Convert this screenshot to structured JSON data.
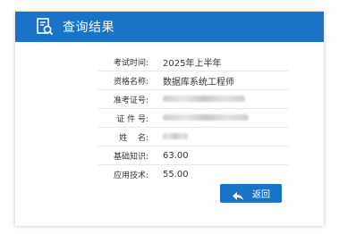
{
  "header": {
    "title": "查询结果",
    "icon": "search-document-icon"
  },
  "results": [
    {
      "label": "考试时间:",
      "value": "2025年上半年",
      "redacted": false
    },
    {
      "label": "资格名称:",
      "value": "数据库系统工程师",
      "redacted": false
    },
    {
      "label": "准考证号:",
      "value": "",
      "redacted": true
    },
    {
      "label": "证 件 号:",
      "value": "",
      "redacted": true
    },
    {
      "label": "姓　 名:",
      "value": "",
      "redacted": true
    },
    {
      "label": "基础知识:",
      "value": "63.00",
      "redacted": false
    },
    {
      "label": "应用技术:",
      "value": "55.00",
      "redacted": false
    }
  ],
  "back_button": {
    "label": "返回",
    "icon": "back-arrow-icon"
  },
  "colors": {
    "accent": "#1a73c7",
    "text": "#333333",
    "divider": "#e8e8e8"
  }
}
